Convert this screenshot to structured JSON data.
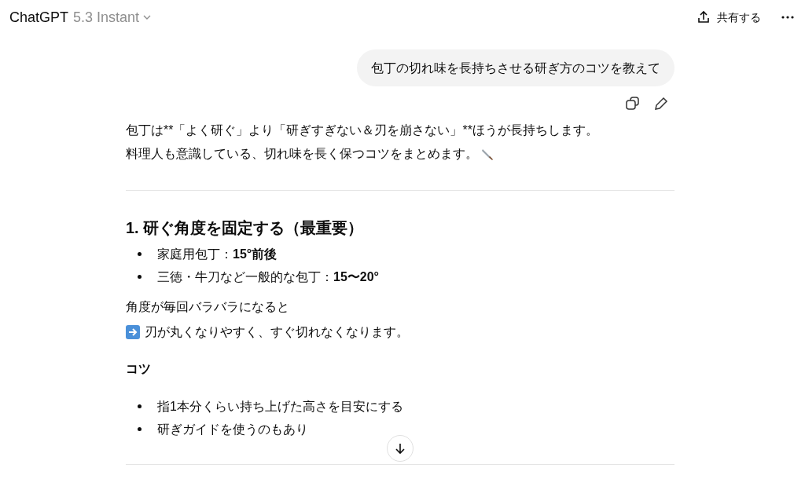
{
  "header": {
    "title": "ChatGPT",
    "model": "5.3 Instant",
    "share_label": "共有する"
  },
  "user_message": "包丁の切れ味を長持ちさせる研ぎ方のコツを教えて",
  "intro_lines": [
    "包丁は**「よく研ぐ」より「研ぎすぎない＆刃を崩さない」**ほうが長持ちします。",
    "料理人も意識している、切れ味を長く保つコツをまとめます。"
  ],
  "section": {
    "heading": "1. 研ぐ角度を固定する（最重要）",
    "bullets": [
      "家庭用包丁：**15°前後**",
      "三徳・牛刀など一般的な包丁：**15〜20°**"
    ],
    "lines": [
      "角度が毎回バラバラになると",
      "刃が丸くなりやすく、すぐ切れなくなります。"
    ],
    "subheading": "コツ",
    "tips": [
      "指1本分くらい持ち上げた高さを目安にする",
      "研ぎガイドを使うのもあり"
    ]
  }
}
